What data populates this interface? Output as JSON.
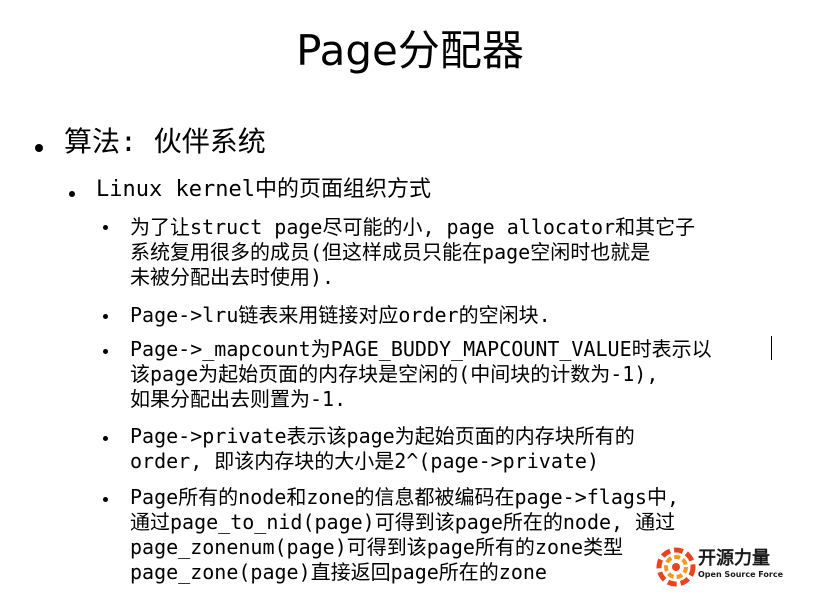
{
  "slide": {
    "title": "Page分配器",
    "level1": {
      "text": "算法: 伙伴系统"
    },
    "level2": {
      "text": "Linux kernel中的页面组织方式"
    },
    "items": [
      {
        "lines": [
          "为了让struct page尽可能的小, page allocator和其它子",
          "系统复用很多的成员(但这样成员只能在page空闲时也就是",
          "未被分配出去时使用)."
        ]
      },
      {
        "lines": [
          "Page->lru链表来用链接对应order的空闲块."
        ]
      },
      {
        "lines": [
          "Page->_mapcount为PAGE_BUDDY_MAPCOUNT_VALUE时表示以",
          "该page为起始页面的内存块是空闲的(中间块的计数为-1),",
          "如果分配出去则置为-1."
        ]
      },
      {
        "lines": [
          "Page->private表示该page为起始页面的内存块所有的",
          "order, 即该内存块的大小是2^(page->private)"
        ]
      },
      {
        "lines": [
          "Page所有的node和zone的信息都被编码在page->flags中,",
          "通过page_to_nid(page)可得到该page所在的node, 通过",
          "page_zonenum(page)可得到该page所有的zone类型",
          "page_zone(page)直接返回page所在的zone"
        ]
      }
    ]
  },
  "logo": {
    "name_cn": "开源力量",
    "name_en": "Open Source Force",
    "colors": {
      "ring": "#e8451f",
      "accent": "#f39a1e"
    }
  }
}
